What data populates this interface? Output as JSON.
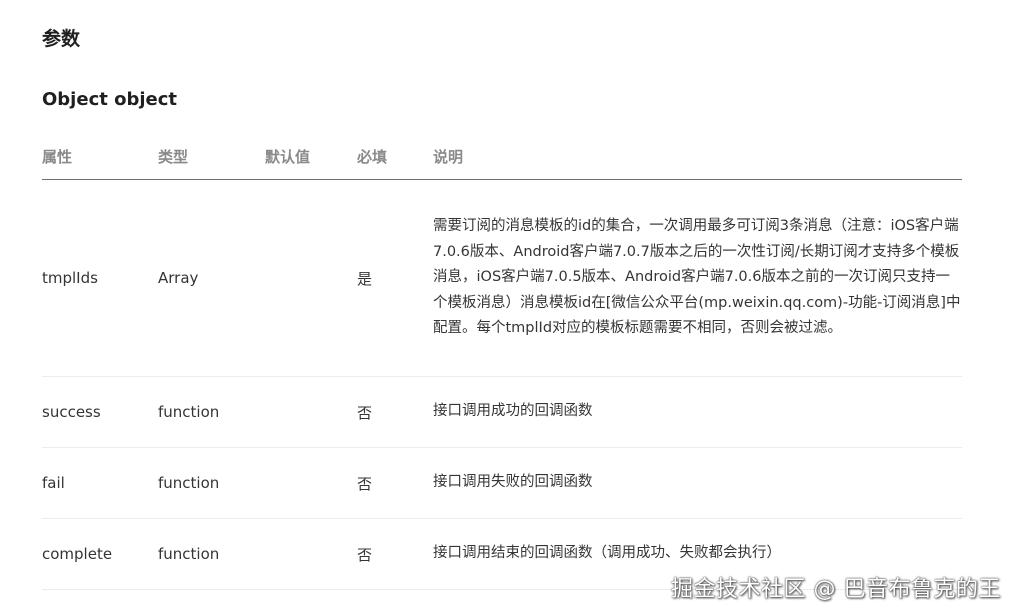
{
  "section_title": "参数",
  "object_title": "Object object",
  "table": {
    "headers": {
      "attr": "属性",
      "type": "类型",
      "default": "默认值",
      "required": "必填",
      "desc": "说明"
    },
    "rows": [
      {
        "name": "tmplIds",
        "type": "Array",
        "default": "",
        "required": "是",
        "desc": "需要订阅的消息模板的id的集合，一次调用最多可订阅3条消息（注意：iOS客户端7.0.6版本、Android客户端7.0.7版本之后的一次性订阅/长期订阅才支持多个模板消息，iOS客户端7.0.5版本、Android客户端7.0.6版本之前的一次订阅只支持一个模板消息）消息模板id在[微信公众平台(mp.weixin.qq.com)-功能-订阅消息]中配置。每个tmplId对应的模板标题需要不相同，否则会被过滤。"
      },
      {
        "name": "success",
        "type": "function",
        "default": "",
        "required": "否",
        "desc": "接口调用成功的回调函数"
      },
      {
        "name": "fail",
        "type": "function",
        "default": "",
        "required": "否",
        "desc": "接口调用失败的回调函数"
      },
      {
        "name": "complete",
        "type": "function",
        "default": "",
        "required": "否",
        "desc": "接口调用结束的回调函数（调用成功、失败都会执行）"
      }
    ]
  },
  "watermark": "掘金技术社区 @ 巴音布鲁克的王"
}
